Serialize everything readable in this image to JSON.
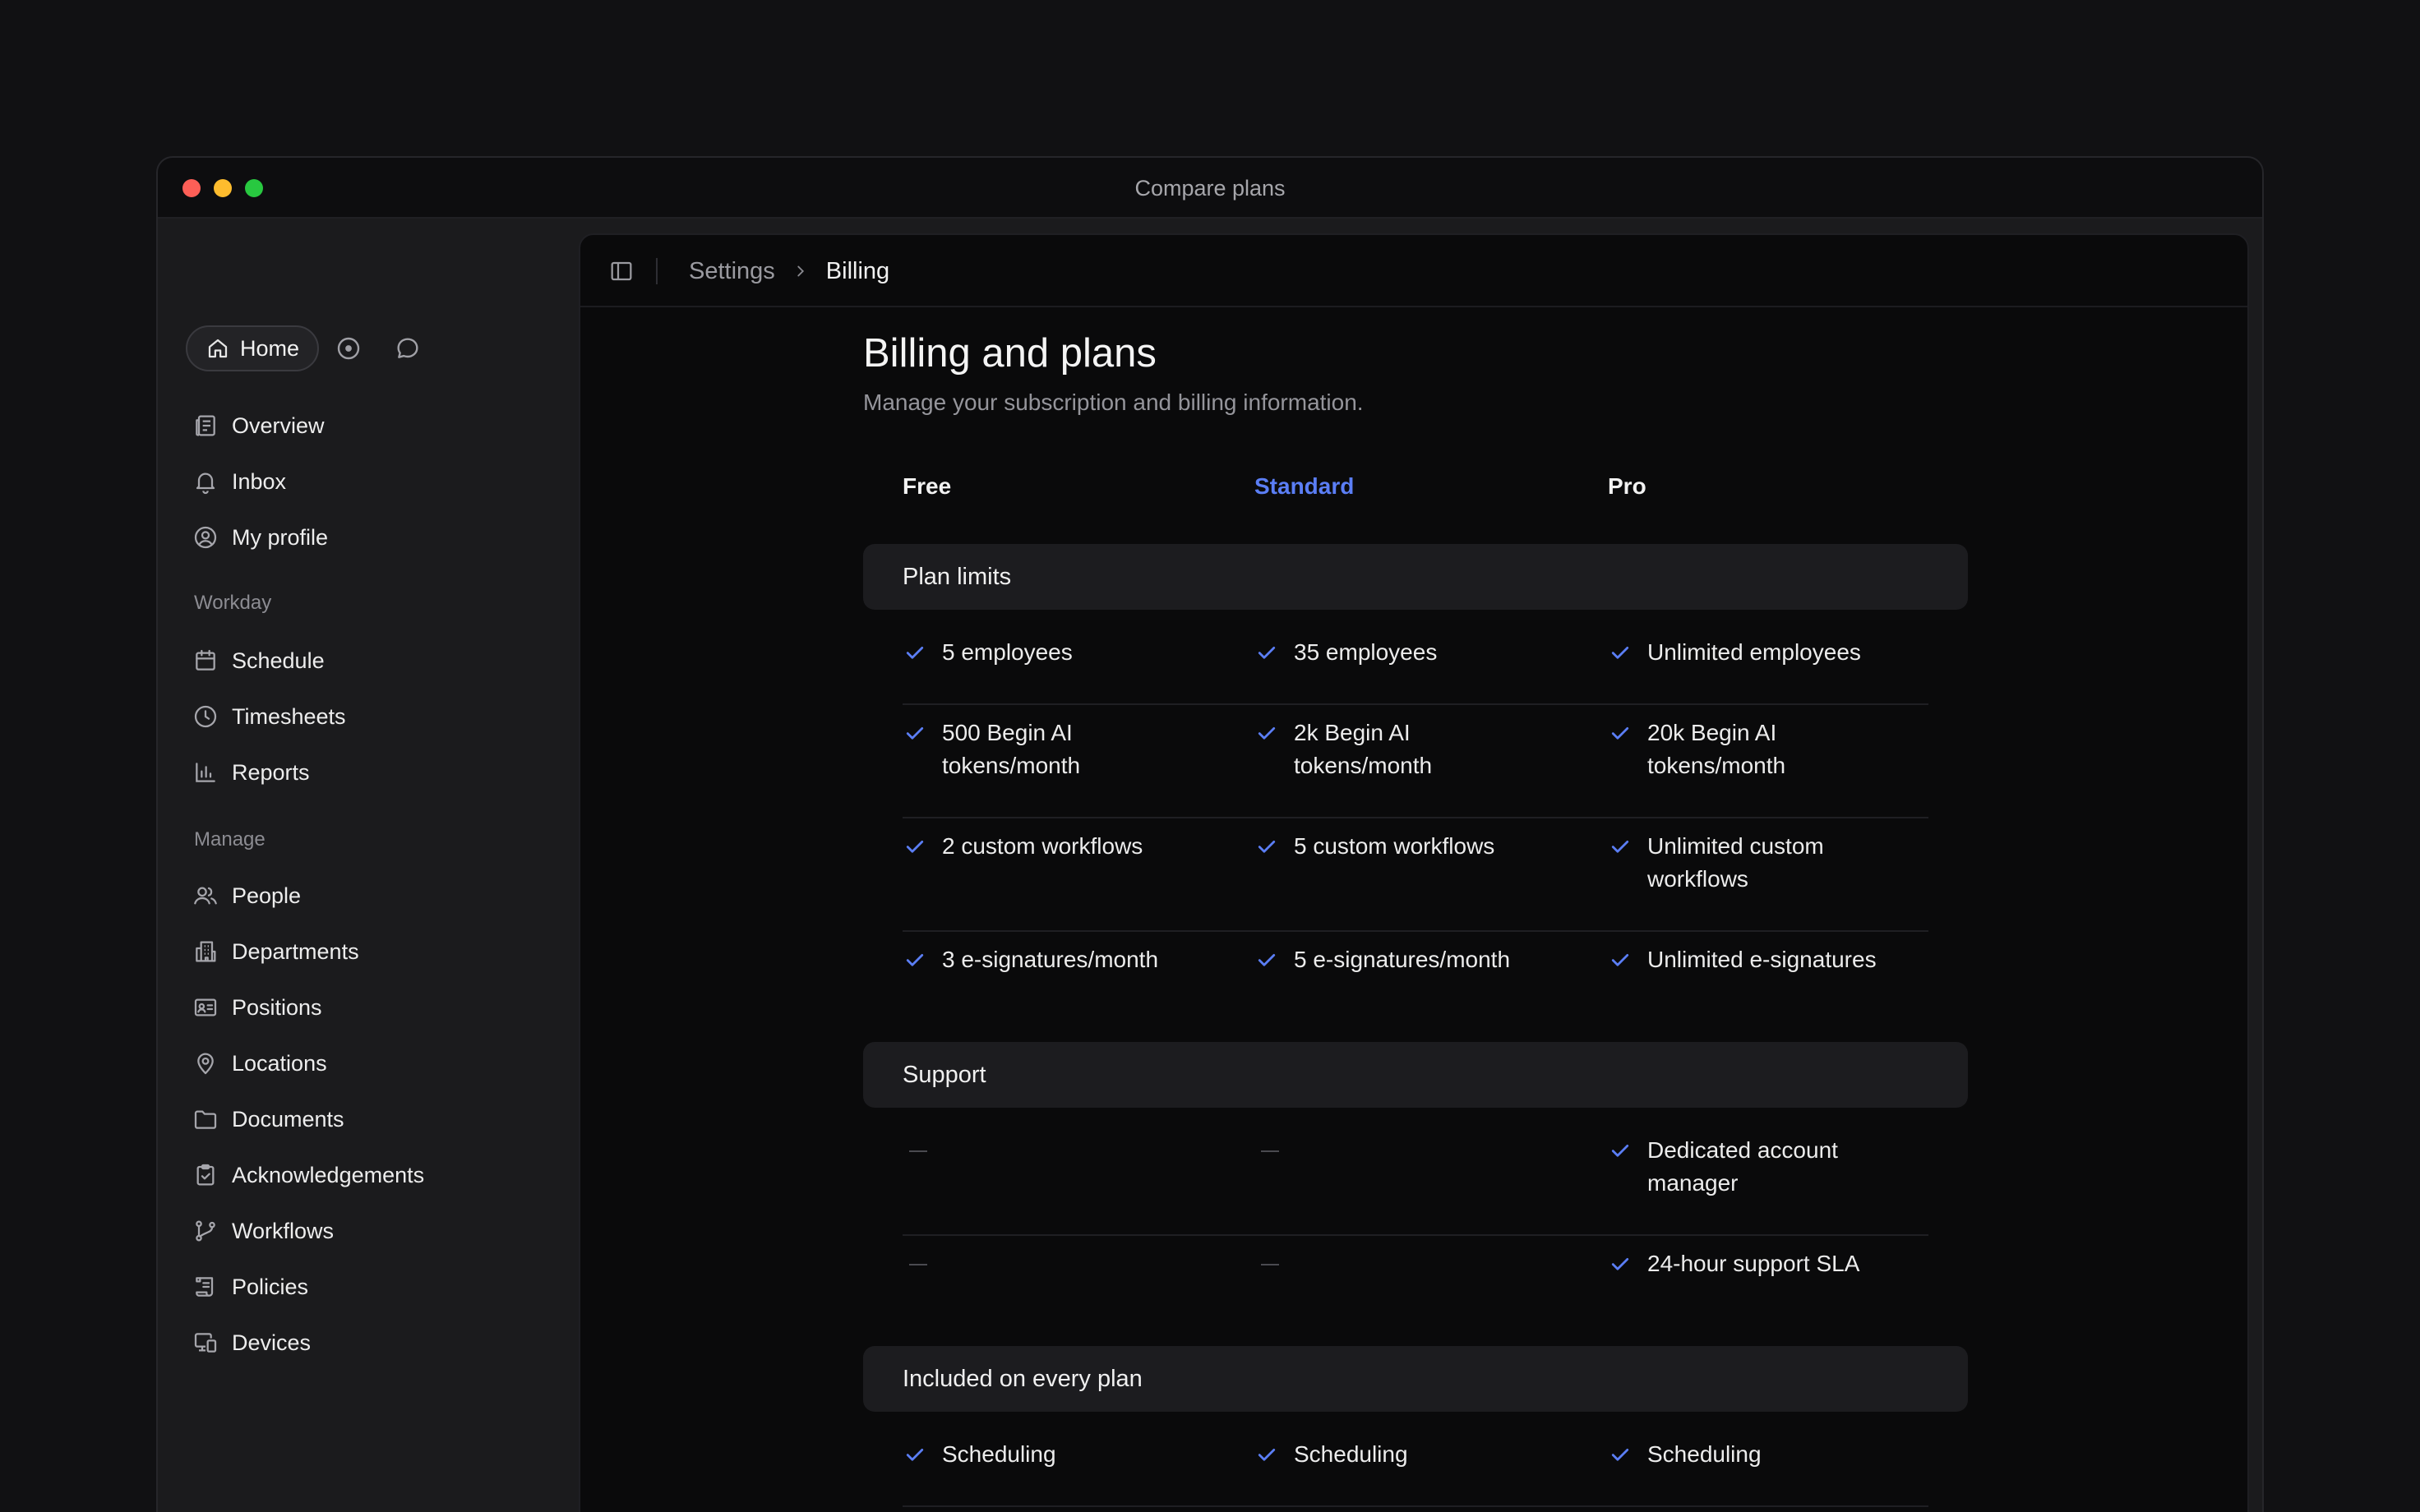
{
  "window": {
    "title": "Compare plans"
  },
  "sidebar": {
    "home_label": "Home",
    "top_items": [
      {
        "label": "Overview",
        "icon": "overview-icon"
      },
      {
        "label": "Inbox",
        "icon": "bell-icon"
      },
      {
        "label": "My profile",
        "icon": "user-circle-icon"
      }
    ],
    "sections": [
      {
        "title": "Workday",
        "items": [
          {
            "label": "Schedule",
            "icon": "calendar-icon"
          },
          {
            "label": "Timesheets",
            "icon": "clock-icon"
          },
          {
            "label": "Reports",
            "icon": "bar-chart-icon"
          }
        ]
      },
      {
        "title": "Manage",
        "items": [
          {
            "label": "People",
            "icon": "users-icon"
          },
          {
            "label": "Departments",
            "icon": "building-icon"
          },
          {
            "label": "Positions",
            "icon": "id-card-icon"
          },
          {
            "label": "Locations",
            "icon": "map-pin-icon"
          },
          {
            "label": "Documents",
            "icon": "folder-icon"
          },
          {
            "label": "Acknowledgements",
            "icon": "clipboard-check-icon"
          },
          {
            "label": "Workflows",
            "icon": "git-branch-icon"
          },
          {
            "label": "Policies",
            "icon": "scroll-icon"
          },
          {
            "label": "Devices",
            "icon": "devices-icon"
          }
        ]
      }
    ]
  },
  "breadcrumb": {
    "parent": "Settings",
    "current": "Billing"
  },
  "page": {
    "title": "Billing and plans",
    "subtitle": "Manage your subscription and billing information."
  },
  "plans": [
    "Free",
    "Standard",
    "Pro"
  ],
  "active_plan": "Standard",
  "colors": {
    "accent": "#5b7ef5",
    "check": "#5b7ef5"
  },
  "sections": [
    {
      "title": "Plan limits",
      "rows": [
        [
          "5 employees",
          "35 employees",
          "Unlimited employees"
        ],
        [
          "500 Begin AI tokens/month",
          "2k Begin AI tokens/month",
          "20k Begin AI tokens/month"
        ],
        [
          "2 custom workflows",
          "5 custom workflows",
          "Unlimited custom workflows"
        ],
        [
          "3 e-signatures/month",
          "5 e-signatures/month",
          "Unlimited e-signatures"
        ]
      ]
    },
    {
      "title": "Support",
      "rows": [
        [
          null,
          null,
          "Dedicated account manager"
        ],
        [
          null,
          null,
          "24-hour support SLA"
        ]
      ]
    },
    {
      "title": "Included on every plan",
      "rows": [
        [
          "Scheduling",
          "Scheduling",
          "Scheduling"
        ]
      ]
    }
  ]
}
